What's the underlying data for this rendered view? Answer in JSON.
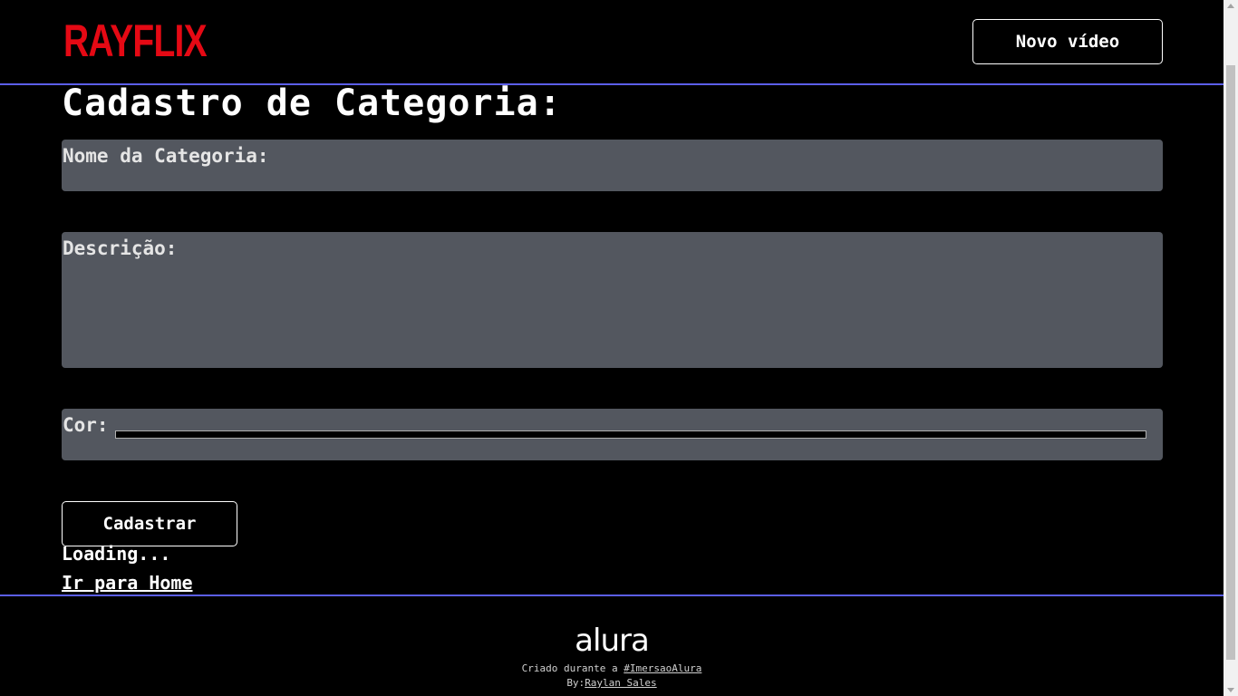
{
  "header": {
    "logo": "RAYFLIX",
    "new_video_button": "Novo vídeo"
  },
  "main": {
    "title": "Cadastro de Categoria:",
    "fields": {
      "name_label": "Nome da Categoria:",
      "description_label": "Descrição:",
      "color_label": "Cor:",
      "color_value": "#000000"
    },
    "submit_button": "Cadastrar",
    "loading_text": "Loading...",
    "home_link": "Ir para Home"
  },
  "footer": {
    "logo": "alura",
    "created_prefix": "Criado durante a ",
    "created_link": "#ImersaoAlura",
    "by_prefix": "By:",
    "by_link": "Raylan Sales"
  },
  "colors": {
    "background": "#000000",
    "brand": "#e50914",
    "field_background": "#53575f",
    "divider": "#5b5ee8"
  }
}
